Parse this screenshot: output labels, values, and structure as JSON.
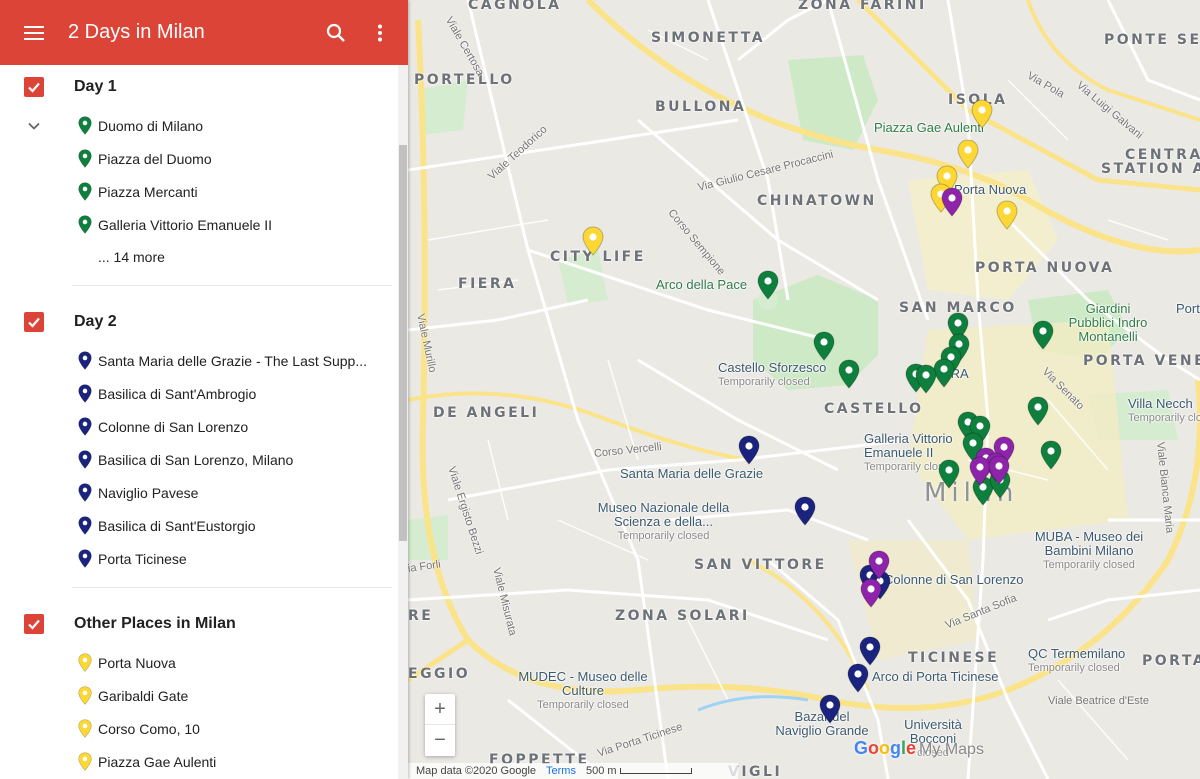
{
  "header": {
    "title": "2 Days in Milan"
  },
  "layers": [
    {
      "name": "Day 1",
      "color": "#0f7f3e",
      "items": [
        "Duomo di Milano",
        "Piazza del Duomo",
        "Piazza Mercanti",
        "Galleria Vittorio Emanuele II"
      ],
      "more": "... 14 more"
    },
    {
      "name": "Day 2",
      "color": "#1a237e",
      "items": [
        "Santa Maria delle Grazie - The Last Supp...",
        "Basilica di Sant'Ambrogio",
        "Colonne di San Lorenzo",
        "Basilica di San Lorenzo, Milano",
        "Naviglio Pavese",
        "Basilica di Sant'Eustorgio",
        "Porta Ticinese"
      ]
    },
    {
      "name": "Other Places in Milan",
      "color": "#fdd835",
      "items": [
        "Porta Nuova",
        "Garibaldi Gate",
        "Corso Como, 10",
        "Piazza Gae Aulenti"
      ]
    }
  ],
  "map": {
    "areas": [
      "CAGNOLA",
      "ZONA FARINI",
      "SIMONETTA",
      "PONTE SEVE",
      "PORTELLO",
      "BULLONA",
      "ISOLA",
      "CENTRA",
      "STATION A",
      "CHINATOWN",
      "CITY LIFE",
      "FIERA",
      "PORTA NUOVA",
      "SAN MARCO",
      "PORTA VENE",
      "CASTELLO",
      "DE ANGELI",
      "SAN VITTORE",
      "ZONA SOLARI",
      "RE",
      "TICINESE",
      "PORTA",
      "EGGIO",
      "FOPPETTE",
      "VIGLI"
    ],
    "city": "Milan",
    "pois": {
      "gae_aulenti": "Piazza Gae Aulenti",
      "porta_nuova": "Porta Nuova",
      "arco_pace": "Arco della Pace",
      "castello": "Castello Sforzesco",
      "castello_sub": "Temporarily closed",
      "galleria": "Galleria Vittorio Emanuele II",
      "galleria_sub": "Temporarily closed",
      "santa_maria": "Santa Maria delle Grazie",
      "museo": "Museo Nazionale della Scienza e della...",
      "museo_sub": "Temporarily closed",
      "colonne": "Colonne di San Lorenzo",
      "giardini": "Giardini Pubblici Indro Montanelli",
      "villa": "Villa Necch",
      "villa_sub": "Temporarily clo",
      "muba": "MUBA - Museo dei Bambini Milano",
      "muba_sub": "Temporarily closed",
      "qc": "QC Termemilano",
      "qc_sub": "Temporarily closed",
      "arco_ticinese": "Arco di Porta Ticinese",
      "mudec": "MUDEC - Museo delle Culture",
      "mudec_sub": "Temporarily closed",
      "bazar": "Bazar del Naviglio Grande",
      "universita": "Università Bocconi",
      "universita_sub": "closed",
      "porta_station": "Porta",
      "era": "ERA"
    },
    "streets": [
      "Viale Certosa",
      "Viale Teodorico",
      "Via Giulio Cesare Procaccini",
      "Corso Sempione",
      "Via Pola",
      "Via Luigi Galvani",
      "Viale Murillo",
      "Viale Ergisto Bezzi",
      "Viale Misurata",
      "Corso Vercelli",
      "Via Senato",
      "Viale Bianca Maria",
      "Via Santa Sofia",
      "Viale Beatrice d'Este",
      "Via Porta Ticinese",
      "ia Forli"
    ],
    "footer": {
      "data": "Map data ©2020 Google",
      "terms": "Terms",
      "scale": "500 m"
    },
    "brand": {
      "g": "Google",
      "mm": "My Maps"
    }
  }
}
